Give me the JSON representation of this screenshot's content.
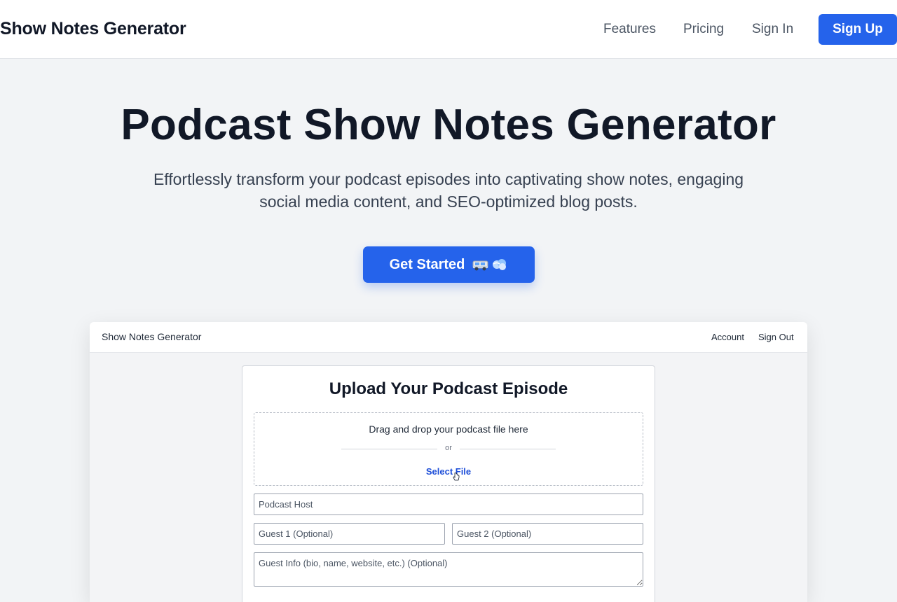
{
  "nav": {
    "brand": "Show Notes Generator",
    "links": [
      "Features",
      "Pricing",
      "Sign In"
    ],
    "signup": "Sign Up",
    "accent": "#2563eb"
  },
  "hero": {
    "title": "Podcast Show Notes Generator",
    "subtitle": "Effortlessly transform your podcast episodes into captivating show notes, engaging social media content, and SEO-optimized blog posts.",
    "cta": "Get Started",
    "cta_icons": [
      "car-icon",
      "dash-icon"
    ]
  },
  "app_preview": {
    "brand": "Show Notes Generator",
    "account": "Account",
    "sign_out": "Sign Out",
    "upload": {
      "title": "Upload Your Podcast Episode",
      "drop_text": "Drag and drop your podcast file here",
      "or": "or",
      "select_file": "Select File"
    },
    "fields": {
      "host_placeholder": "Podcast Host",
      "guest1_placeholder": "Guest 1 (Optional)",
      "guest2_placeholder": "Guest 2 (Optional)",
      "guest_info_placeholder": "Guest Info (bio, name, website, etc.) (Optional)"
    }
  }
}
